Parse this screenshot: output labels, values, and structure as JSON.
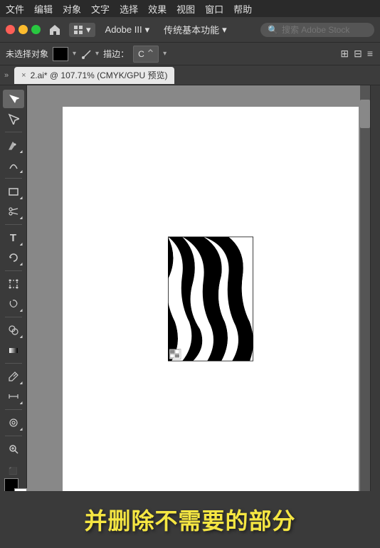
{
  "menu": {
    "items": [
      "文件",
      "编辑",
      "对象",
      "文字",
      "选择",
      "效果",
      "视图",
      "窗口",
      "帮助"
    ]
  },
  "toolbar1": {
    "workspace": "Adobe III",
    "preset": "传统基本功能",
    "search_placeholder": "搜索 Adobe Stock"
  },
  "toolbar2": {
    "obj_label": "未选择对象",
    "stroke_label": "描边：",
    "stroke_value": "C"
  },
  "tab": {
    "close_icon": "×",
    "title": "2.ai* @ 107.71% (CMYK/GPU 预览)"
  },
  "tools": [
    {
      "name": "select",
      "icon": "▸"
    },
    {
      "name": "direct-select",
      "icon": "↖"
    },
    {
      "name": "pen",
      "icon": "✒"
    },
    {
      "name": "curvature",
      "icon": "⌇"
    },
    {
      "name": "rectangle",
      "icon": "□"
    },
    {
      "name": "blade",
      "icon": "/"
    },
    {
      "name": "text",
      "icon": "T"
    },
    {
      "name": "rotate",
      "icon": "↻"
    },
    {
      "name": "diamond",
      "icon": "◇"
    },
    {
      "name": "lasso",
      "icon": "⌀"
    },
    {
      "name": "shape-builder",
      "icon": "⬡"
    },
    {
      "name": "gradient",
      "icon": "■"
    },
    {
      "name": "eyedropper",
      "icon": "💧"
    },
    {
      "name": "measure",
      "icon": "⊕"
    },
    {
      "name": "warp",
      "icon": "⌀"
    },
    {
      "name": "zoom",
      "icon": "🔍"
    },
    {
      "name": "hand",
      "icon": "✋"
    }
  ],
  "caption": {
    "text": "并删除不需要的部分"
  },
  "colors": {
    "accent_yellow": "#f5e642",
    "background": "#3a3a3a",
    "canvas_bg": "#888888",
    "artboard": "#ffffff"
  }
}
